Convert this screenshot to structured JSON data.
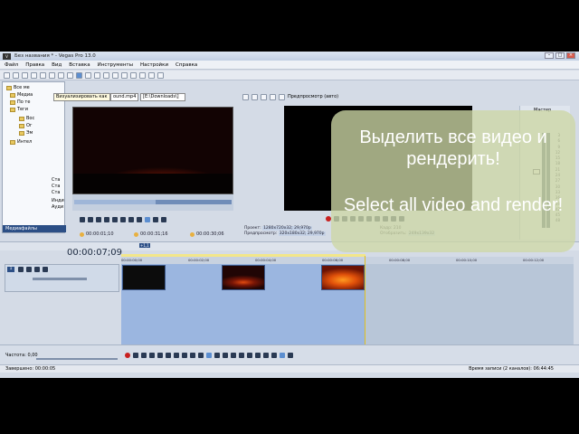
{
  "window": {
    "title": "Без названия * - Vegas Pro 13.0",
    "app_icon": "V"
  },
  "menu": [
    "Файл",
    "Правка",
    "Вид",
    "Вставка",
    "Инструменты",
    "Настройки",
    "Справка"
  ],
  "tooltip": "Визуализировать как",
  "explorer": {
    "items": [
      "Все ме",
      "Медиа",
      "По те",
      "Теги",
      "Вос",
      "Ог",
      "Эм",
      "Интел"
    ],
    "side_items": [
      "Ста",
      "Ста",
      "Ста",
      "Инди",
      "Ауди"
    ],
    "tab": "Медиафайлы"
  },
  "trimmer": {
    "file": "ound.mp4",
    "path": "[E:\\Downloads\\]",
    "timecodes": [
      "00:00:01;10",
      "00:00:31;16",
      "00:00:30;06"
    ]
  },
  "preview": {
    "mode_label": "Предпросмотр (авто)",
    "project_label": "Проект:",
    "project_value": "1280x720x32; 29,970p",
    "preview_label": "Предпросмотр:",
    "preview_value": "320x180x32; 29,970p",
    "frame_label": "Кадр:",
    "frame_value": "210",
    "display_label": "Отобразить:",
    "display_value": "249x139x32"
  },
  "master": {
    "label": "Мастер",
    "scale": [
      "3",
      "6",
      "9",
      "12",
      "15",
      "18",
      "21",
      "24",
      "27",
      "30",
      "33",
      "36",
      "39",
      "42",
      "45",
      "48",
      "51",
      "54",
      "57"
    ]
  },
  "overlay": {
    "ru": "Выделить все видео и рендерить!",
    "en": "Select all video and render!"
  },
  "timeline": {
    "timecode": "00:00:07;09",
    "marker": "+1,1",
    "ruler": [
      "00:00:00;00",
      "00:00:02;00",
      "00:00:04;00",
      "00:00:06;00",
      "00:00:08;00",
      "00:00:10;00",
      "00:00:12;00"
    ],
    "track_number": "1"
  },
  "bottom": {
    "rate": "Частота: 0,00"
  },
  "status": {
    "left": "Завершено: 00:00:05",
    "right": "Время записи (2 каналов): 06:44:45"
  }
}
